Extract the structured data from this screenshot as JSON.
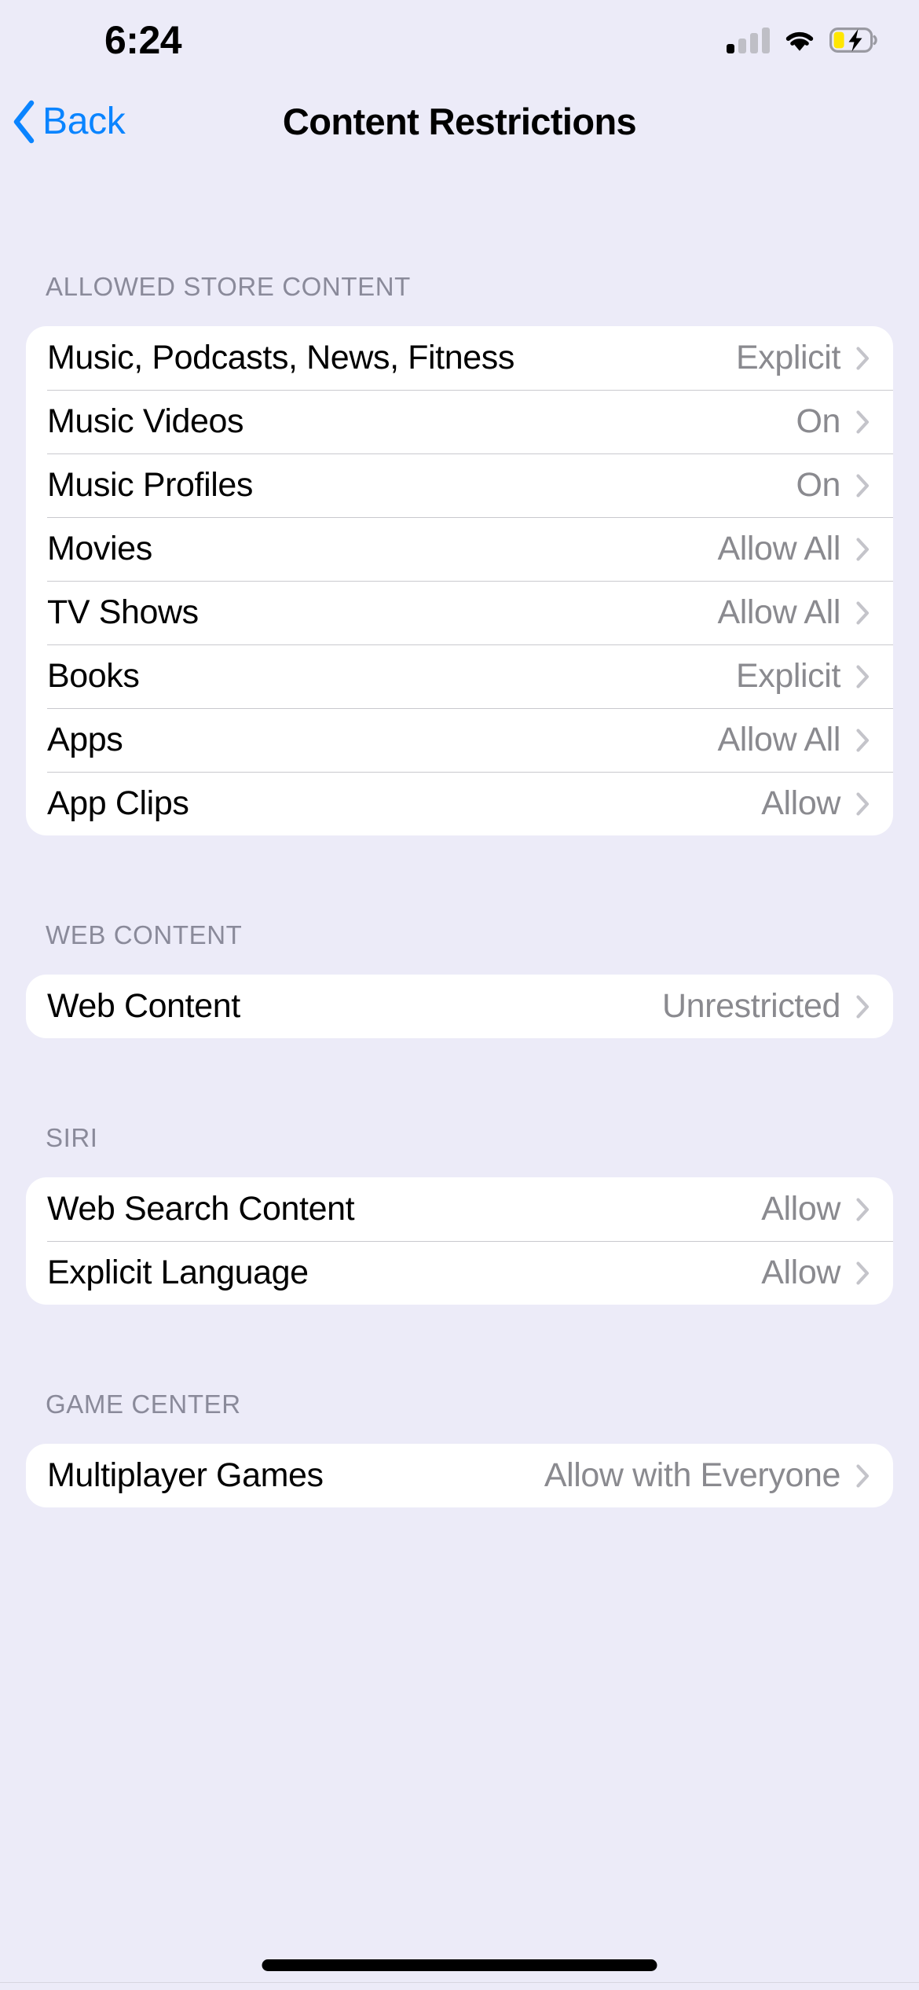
{
  "status_bar": {
    "time": "6:24",
    "cellular_icon": "cellular-signal-icon",
    "cellular_bars_filled": 1,
    "cellular_bars_total": 4,
    "wifi_icon": "wifi-icon",
    "battery_icon": "battery-charging-icon",
    "battery_color": "#FFE600",
    "battery_charging": true
  },
  "nav": {
    "back_label": "Back",
    "back_icon": "chevron-left-icon",
    "title": "Content Restrictions",
    "accent_color": "#0A84FF"
  },
  "sections": [
    {
      "header": "ALLOWED STORE CONTENT",
      "rows": [
        {
          "label": "Music, Podcasts, News, Fitness",
          "value": "Explicit"
        },
        {
          "label": "Music Videos",
          "value": "On"
        },
        {
          "label": "Music Profiles",
          "value": "On"
        },
        {
          "label": "Movies",
          "value": "Allow All"
        },
        {
          "label": "TV Shows",
          "value": "Allow All"
        },
        {
          "label": "Books",
          "value": "Explicit"
        },
        {
          "label": "Apps",
          "value": "Allow All"
        },
        {
          "label": "App Clips",
          "value": "Allow"
        }
      ]
    },
    {
      "header": "WEB CONTENT",
      "rows": [
        {
          "label": "Web Content",
          "value": "Unrestricted"
        }
      ]
    },
    {
      "header": "SIRI",
      "rows": [
        {
          "label": "Web Search Content",
          "value": "Allow"
        },
        {
          "label": "Explicit Language",
          "value": "Allow"
        }
      ]
    },
    {
      "header": "GAME CENTER",
      "rows": [
        {
          "label": "Multiplayer Games",
          "value": "Allow with Everyone"
        }
      ]
    }
  ],
  "colors": {
    "background": "#ECEBF8",
    "card": "#FFFFFF",
    "label": "#000000",
    "value": "#8A8A8F",
    "section_header": "#8A8A9A",
    "separator": "#C9C9CE",
    "chevron": "#C4C4CA"
  },
  "home_indicator": "home-indicator"
}
